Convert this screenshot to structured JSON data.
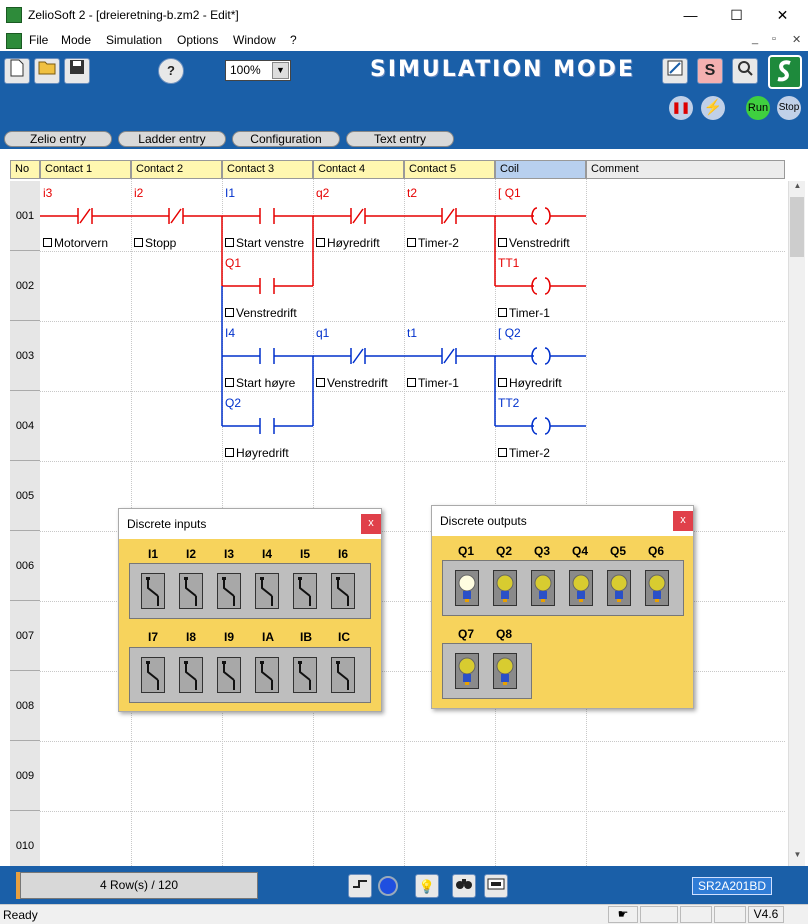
{
  "window": {
    "title": "ZelioSoft 2 - [dreieretning-b.zm2 - Edit*]",
    "min": "—",
    "max": "☐",
    "close": "✕"
  },
  "menu": [
    "File",
    "Mode",
    "Simulation",
    "Options",
    "Window",
    "?"
  ],
  "mdi": {
    "min": "_",
    "restore": "▫",
    "close": "✕"
  },
  "toolbar": {
    "zoom": "100%",
    "mode_banner": "SIMULATION MODE",
    "s_label": "S",
    "run_label": "Run",
    "stop_label": "Stop"
  },
  "tabs": [
    "Zelio entry",
    "Ladder entry",
    "Configuration",
    "Text entry"
  ],
  "columns": [
    "No",
    "Contact 1",
    "Contact 2",
    "Contact 3",
    "Contact 4",
    "Contact 5",
    "Coil",
    "Comment"
  ],
  "rows": [
    "001",
    "002",
    "003",
    "004",
    "005",
    "006",
    "007",
    "008",
    "009",
    "010"
  ],
  "ladder": {
    "r1": {
      "c1": "i3",
      "c1n": "Motorvern",
      "c2": "i2",
      "c2n": "Stopp",
      "c3": "I1",
      "c3n": "Start venstre",
      "c4": "q2",
      "c4n": "Høyredrift",
      "c5": "t2",
      "c5n": "Timer-2",
      "coil": "Q1",
      "coiln": "Venstredrift",
      "coil_prefix": "["
    },
    "r2": {
      "c3": "Q1",
      "c3n": "Venstredrift",
      "coil": "TT1",
      "coiln": "Timer-1"
    },
    "r3": {
      "c3": "I4",
      "c3n": "Start høyre",
      "c4": "q1",
      "c4n": "Venstredrift",
      "c5": "t1",
      "c5n": "Timer-1",
      "coil": "Q2",
      "coiln": "Høyredrift",
      "coil_prefix": "["
    },
    "r4": {
      "c3": "Q2",
      "c3n": "Høyredrift",
      "coil": "TT2",
      "coiln": "Timer-2"
    }
  },
  "inputs_window": {
    "title": "Discrete inputs",
    "close": "x",
    "row1": [
      "I1",
      "I2",
      "I3",
      "I4",
      "I5",
      "I6"
    ],
    "row2": [
      "I7",
      "I8",
      "I9",
      "IA",
      "IB",
      "IC"
    ]
  },
  "outputs_window": {
    "title": "Discrete outputs",
    "close": "x",
    "row1": [
      "Q1",
      "Q2",
      "Q3",
      "Q4",
      "Q5",
      "Q6"
    ],
    "row2": [
      "Q7",
      "Q8"
    ],
    "lit": [
      "Q1"
    ]
  },
  "status": {
    "rowcount": "4 Row(s) / 120",
    "model": "SR2A201BD",
    "ready": "Ready",
    "version": "V4.6"
  },
  "colors": {
    "toolbar_bg": "#1a5fa8",
    "header_bg": "#fff7b0",
    "active_rung": "#e60000",
    "inactive_rung": "#0030cc",
    "panel_bg": "#f7d35c"
  }
}
